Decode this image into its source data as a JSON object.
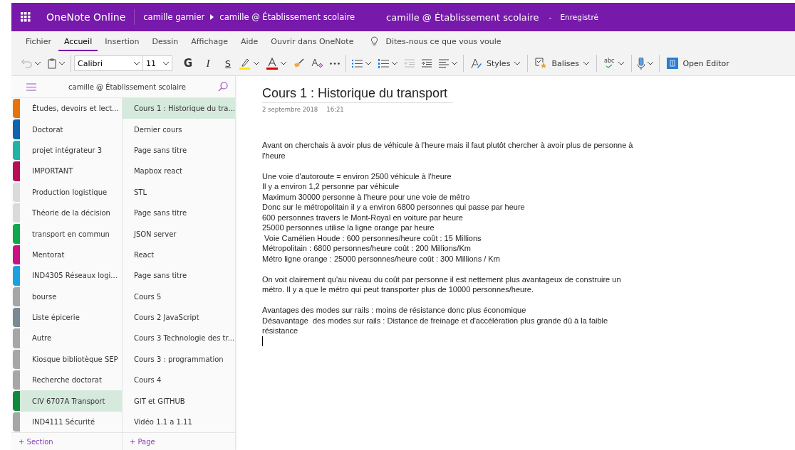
{
  "app_bar": {
    "app_name": "OneNote Online",
    "breadcrumb": [
      "camille garnier",
      "camille @ Établissement scolaire"
    ],
    "notebook_title": "camille @ Établissement scolaire",
    "separator": "-",
    "save_status": "Enregistré"
  },
  "ribbon_tabs": [
    {
      "label": "Fichier",
      "selected": false
    },
    {
      "label": "Accueil",
      "selected": true
    },
    {
      "label": "Insertion",
      "selected": false
    },
    {
      "label": "Dessin",
      "selected": false
    },
    {
      "label": "Affichage",
      "selected": false
    },
    {
      "label": "Aide",
      "selected": false
    },
    {
      "label": "Ouvrir dans OneNote",
      "selected": false
    }
  ],
  "tell_me": {
    "placeholder": "Dites-nous ce que vous voule"
  },
  "toolbar": {
    "font": "Calibri",
    "size": "11",
    "bold": "G",
    "italic": "I",
    "strike": "S",
    "styles": "Styles",
    "tags": "Balises",
    "spelling": "abc",
    "open_editor": "Open Editor"
  },
  "navigation": {
    "notebook": "camille @ Établissement scolaire",
    "sections": [
      {
        "label": "Études, devoirs et lect...",
        "color": "#e8730c",
        "selected": false
      },
      {
        "label": "Doctorat",
        "color": "#0f64b0",
        "selected": false
      },
      {
        "label": "projet intégrateur 3",
        "color": "#1fb5a6",
        "selected": false
      },
      {
        "label": "IMPORTANT",
        "color": "#b80d57",
        "selected": false
      },
      {
        "label": "Production logistique",
        "color": "#dadada",
        "selected": false
      },
      {
        "label": "Théorie de la décision",
        "color": "#dadada",
        "selected": false
      },
      {
        "label": "transport en commun",
        "color": "#0fa84c",
        "selected": false
      },
      {
        "label": "Mentorat",
        "color": "#cc1280",
        "selected": false
      },
      {
        "label": "IND4305 Réseaux logi...",
        "color": "#1ba1dd",
        "selected": false
      },
      {
        "label": "bourse",
        "color": "#a6a6a6",
        "selected": false
      },
      {
        "label": "Liste épicerie",
        "color": "#7a8a92",
        "selected": false
      },
      {
        "label": "Autre",
        "color": "#a6a6a6",
        "selected": false
      },
      {
        "label": "Kiosque bibliotèque SEP",
        "color": "#a6a6a6",
        "selected": false
      },
      {
        "label": "Recherche doctorat",
        "color": "#a6a6a6",
        "selected": false
      },
      {
        "label": "CIV 6707A Transport",
        "color": "#108a3a",
        "selected": true
      },
      {
        "label": "IND4111 Sécurité",
        "color": "#a6a6a6",
        "selected": false
      }
    ],
    "pages": [
      {
        "label": "Cours 1 : Historique du tra...",
        "selected": true
      },
      {
        "label": "Dernier cours",
        "selected": false
      },
      {
        "label": "Page sans titre",
        "selected": false
      },
      {
        "label": "Mapbox react",
        "selected": false
      },
      {
        "label": "STL",
        "selected": false
      },
      {
        "label": "Page sans titre",
        "selected": false
      },
      {
        "label": "JSON server",
        "selected": false
      },
      {
        "label": "React",
        "selected": false
      },
      {
        "label": "Page sans titre",
        "selected": false
      },
      {
        "label": "Cours 5",
        "selected": false
      },
      {
        "label": "Cours 2 JavaScript",
        "selected": false
      },
      {
        "label": "Cours 3 Technologie des tr...",
        "selected": false
      },
      {
        "label": "Cours 3 : programmation",
        "selected": false
      },
      {
        "label": "Cours 4",
        "selected": false
      },
      {
        "label": "GIT et GITHUB",
        "selected": false
      },
      {
        "label": "Vidéo 1.1 a 1.11",
        "selected": false
      }
    ],
    "add_section": "+ Section",
    "add_page": "+ Page"
  },
  "page": {
    "title": "Cours 1 : Historique du transport",
    "date": "2 septembre 2018",
    "time": "16:21",
    "paragraphs": [
      [
        "Avant on cherchais à avoir plus de véhicule à l'heure mais il faut plutôt chercher à avoir plus de personne à l'heure"
      ],
      [
        "Une voie d'autoroute = environ 2500 véhicule à l'heure",
        "Il y a environ 1,2 personne par véhicule",
        "Maximum 30000 personne à l'heure pour une voie de métro",
        "Donc sur le métropolitain il y a environ 6800 personnes qui passe par heure",
        "600 personnes travers le Mont-Royal en voiture par heure",
        "25000 personnes utilise la ligne orange par heure",
        " Voie Camélien Houde : 600 personnes/heure coût : 15 Millions",
        "Métropolitain : 6800 personnes/heure coût : 200 Millions/Km",
        "Métro ligne orange : 25000 personnes/heure coût : 300 Millions / Km"
      ],
      [
        "On voit clairement qu'au niveau du coût par personne il est nettement plus avantageux de construire un métro. Il y a que le métro qui peut transporter plus de 10000 personnes/heure."
      ],
      [
        "Avantages des modes sur rails : moins de résistance donc plus économique",
        "Désavantage  des modes sur rails : Distance de freinage et d'accélération plus grande dû à la faible résistance"
      ]
    ]
  }
}
